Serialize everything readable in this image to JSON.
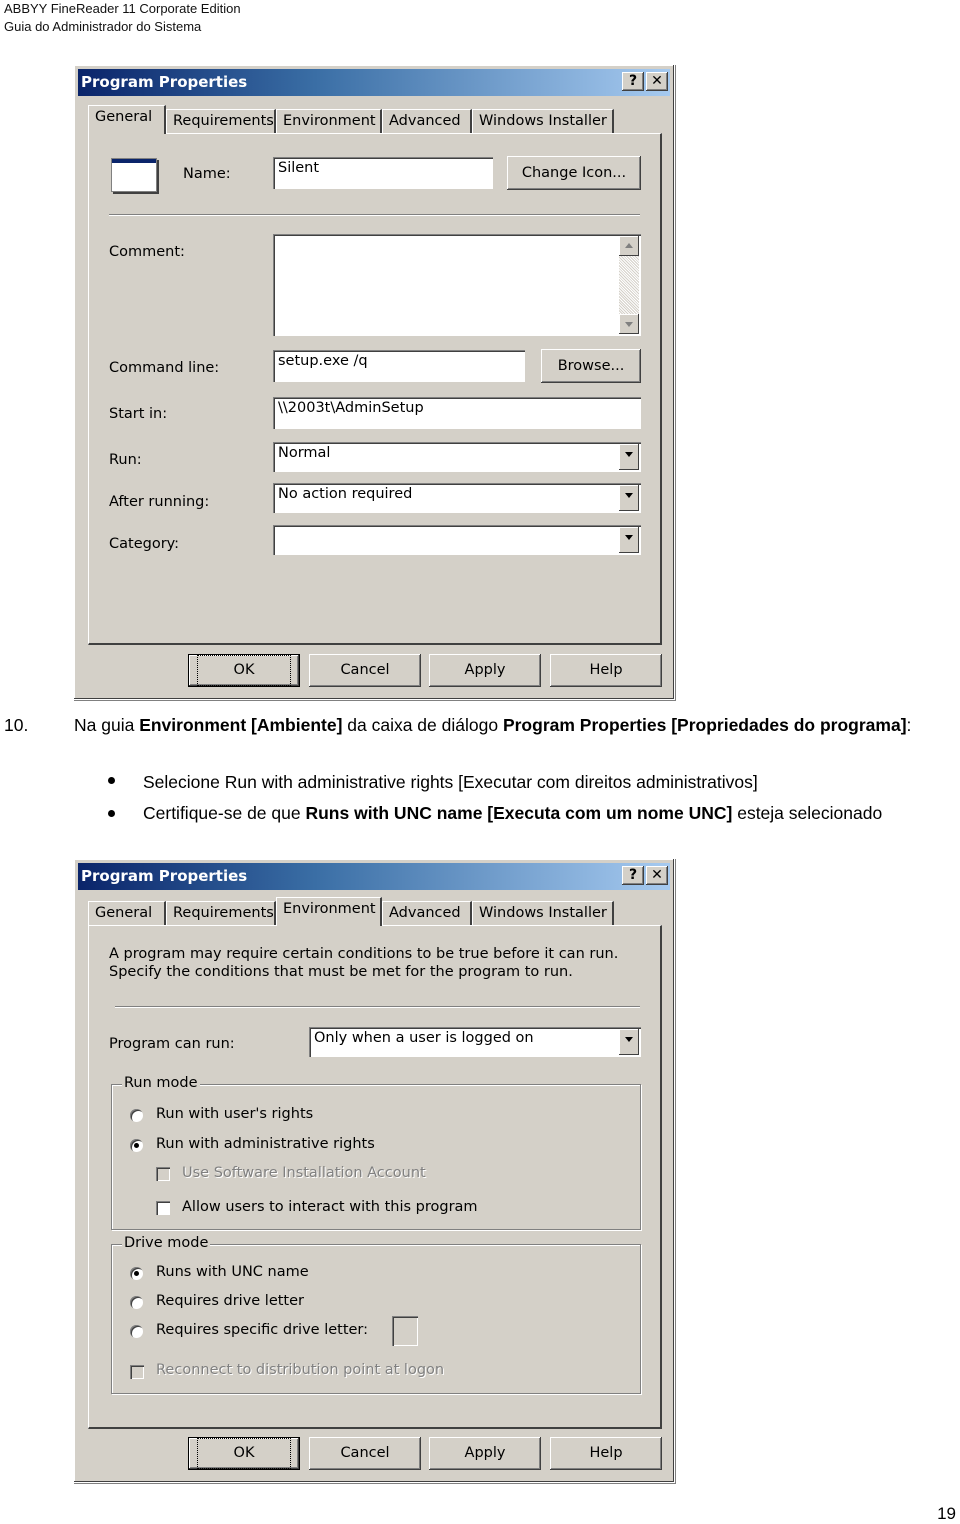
{
  "header": {
    "line1": "ABBYY FineReader 11 Corporate Edition",
    "line2": "Guia do Administrador do Sistema"
  },
  "page_number": "19",
  "dialog_common": {
    "title": "Program Properties",
    "help_button": "?",
    "close_button": "✕",
    "tabs": [
      "General",
      "Requirements",
      "Environment",
      "Advanced",
      "Windows Installer"
    ],
    "buttons": {
      "ok": "OK",
      "cancel": "Cancel",
      "apply": "Apply",
      "help": "Help"
    }
  },
  "dialog1": {
    "active_tab": "General",
    "name_label": "Name:",
    "name_value": "Silent",
    "change_icon_button": "Change Icon...",
    "comment_label": "Comment:",
    "comment_value": "",
    "command_line_label": "Command line:",
    "command_line_value": "setup.exe /q",
    "browse_button": "Browse...",
    "start_in_label": "Start in:",
    "start_in_value": "\\\\2003t\\AdminSetup",
    "run_label": "Run:",
    "run_value": "Normal",
    "after_running_label": "After running:",
    "after_running_value": "No action required",
    "category_label": "Category:",
    "category_value": ""
  },
  "instructions": {
    "step_number": "10.",
    "intro_parts": [
      {
        "text": "Na guia ",
        "bold": false
      },
      {
        "text": "Environment [Ambiente]",
        "bold": true
      },
      {
        "text": " da caixa de diálogo ",
        "bold": false
      },
      {
        "text": "Program Properties [Propriedades do programa]",
        "bold": true
      },
      {
        "text": ":",
        "bold": false
      }
    ],
    "bullet1": "Selecione Run with administrative rights [Executar com direitos administrativos]",
    "bullet2_prefix": "Certifique-se de que ",
    "bullet2_bold": "Runs with UNC name [Executa com um nome UNC]",
    "bullet2_suffix": " esteja selecionado"
  },
  "dialog2": {
    "active_tab": "Environment",
    "description_line1": "A program may require certain conditions to be true before it can run.",
    "description_line2": "Specify the conditions that must be met for the program to run.",
    "program_can_run_label": "Program can run:",
    "program_can_run_value": "Only when a user is logged on",
    "run_mode": {
      "label": "Run mode",
      "option_user": "Run with user's rights",
      "option_admin": "Run with administrative rights",
      "selected": "admin",
      "use_software_installation_account": "Use Software Installation Account",
      "use_software_installation_account_checked": false,
      "use_software_installation_account_enabled": false,
      "allow_interact": "Allow users to interact with this program",
      "allow_interact_checked": false
    },
    "drive_mode": {
      "label": "Drive mode",
      "option_unc": "Runs with UNC name",
      "option_drive_letter": "Requires drive letter",
      "option_specific": "Requires specific drive letter:",
      "selected": "unc",
      "specific_letter_value": "",
      "reconnect": "Reconnect to distribution point at logon",
      "reconnect_checked": false,
      "reconnect_enabled": false
    }
  }
}
